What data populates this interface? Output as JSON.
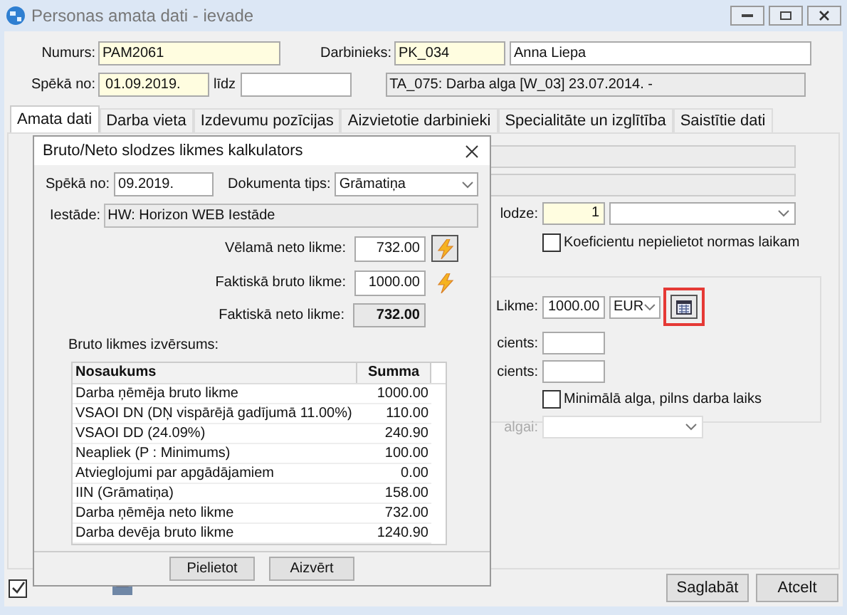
{
  "window": {
    "title": "Personas amata dati - ievade"
  },
  "header": {
    "numurs": {
      "label": "Numurs:",
      "value": "PAM2061"
    },
    "darbinieks": {
      "label": "Darbinieks:",
      "code": "PK_034",
      "name": "Anna Liepa"
    },
    "speka_no": {
      "label": "Spēkā no:",
      "value": "01.09.2019."
    },
    "lidz": {
      "label": "līdz"
    },
    "info": "TA_075: Darba alga [W_03] 23.07.2014. -"
  },
  "tabs": [
    {
      "label": "Amata dati",
      "selected": true
    },
    {
      "label": "Darba vieta",
      "selected": false
    },
    {
      "label": "Izdevumu pozīcijas",
      "selected": false
    },
    {
      "label": "Aizvietotie darbinieki",
      "selected": false
    },
    {
      "label": "Specialitāte un izglītība",
      "selected": false
    },
    {
      "label": "Saistītie dati",
      "selected": false
    }
  ],
  "form": {
    "slodze": {
      "label": "lodze:",
      "value": "1"
    },
    "koef_checkbox": {
      "label": "Koeficientu nepielietot normas laikam",
      "checked": false
    },
    "likme": {
      "label": "Likme:",
      "value": "1000.00",
      "currency": "EUR"
    },
    "koef_1": {
      "label": "cients:"
    },
    "koef_2": {
      "label": "cients:"
    },
    "min_checkbox": {
      "label": "Minimālā alga, pilns darba laiks",
      "checked": false
    },
    "algai": {
      "label": "algai:"
    }
  },
  "dialog": {
    "title": "Bruto/Neto slodzes likmes kalkulators",
    "speka_no": {
      "label": "Spēkā no:",
      "value": "09.2019."
    },
    "dokumenta_tips": {
      "label": "Dokumenta tips:",
      "value": "Grāmatiņa"
    },
    "iestade": {
      "label": "Iestāde:",
      "value": "HW: Horizon WEB Iestāde"
    },
    "velama_neto": {
      "label": "Vēlamā neto likme:",
      "value": "732.00"
    },
    "faktiska_bruto": {
      "label": "Faktiskā bruto likme:",
      "value": "1000.00"
    },
    "faktiska_neto": {
      "label": "Faktiskā neto likme:",
      "value": "732.00"
    },
    "breakdown_label": "Bruto likmes izvērsums:",
    "table": {
      "columns": [
        "Nosaukums",
        "Summa"
      ],
      "rows": [
        [
          "Darba ņēmēja bruto likme",
          "1000.00"
        ],
        [
          "VSAOI DN (DŅ vispārējā gadījumā 11.00%)",
          "110.00"
        ],
        [
          "VSAOI DD (24.09%)",
          "240.90"
        ],
        [
          "Neapliek (P : Minimums)",
          "100.00"
        ],
        [
          "Atvieglojumi par apgādājamiem",
          "0.00"
        ],
        [
          "IIN (Grāmatiņa)",
          "158.00"
        ],
        [
          "Darba ņēmēja neto likme",
          "732.00"
        ],
        [
          "Darba devēja bruto likme",
          "1240.90"
        ]
      ]
    },
    "buttons": [
      "Pielietot",
      "Aizvērt"
    ]
  },
  "footer": {
    "approved_checked": true,
    "buttons": [
      "Saglabāt",
      "Atcelt"
    ]
  }
}
